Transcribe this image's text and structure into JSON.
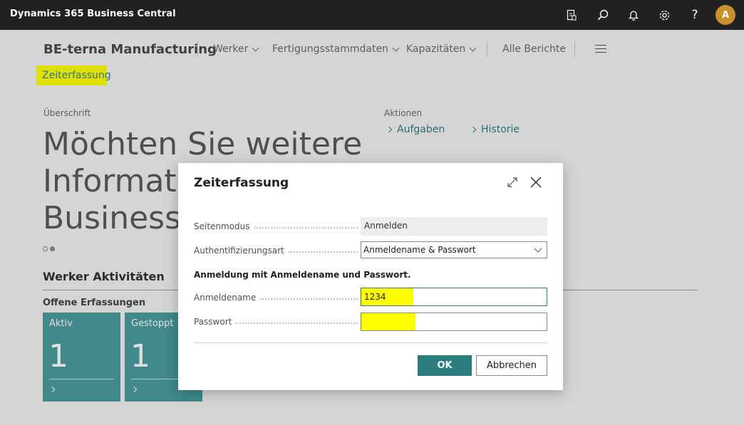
{
  "app": {
    "title": "Dynamics 365 Business Central",
    "avatar_initial": "A"
  },
  "topbar_icons": [
    "document-icon",
    "search-icon",
    "bell-icon",
    "gear-icon",
    "help-icon"
  ],
  "header": {
    "company": "BE-terna Manufacturing",
    "nav": [
      {
        "label": "Werker"
      },
      {
        "label": "Fertigungsstammdaten"
      },
      {
        "label": "Kapazitäten"
      }
    ],
    "all_reports": "Alle Berichte",
    "highlight_link": "Zeiterfassung"
  },
  "headline": {
    "caption": "Überschrift",
    "lines": [
      "Möchten Sie weitere",
      "Informatio",
      "Business C"
    ]
  },
  "actions": {
    "caption": "Aktionen",
    "items": [
      "Aufgaben",
      "Historie"
    ]
  },
  "activities": {
    "title": "Werker Aktivitäten",
    "subtitle": "Offene Erfassungen",
    "tiles": [
      {
        "label": "Aktiv",
        "value": "1"
      },
      {
        "label": "Gestoppt",
        "value": "1"
      }
    ]
  },
  "dialog": {
    "title": "Zeiterfassung",
    "fields": {
      "page_mode": {
        "label": "Seitenmodus",
        "value": "Anmelden"
      },
      "auth_type": {
        "label": "Authentifizierungsart",
        "value": "Anmeldename & Passwort"
      },
      "group_heading": "Anmeldung mit Anmeldename und Passwort.",
      "login_name": {
        "label": "Anmeldename",
        "value": "1234"
      },
      "password": {
        "label": "Passwort",
        "value": ""
      }
    },
    "buttons": {
      "ok": "OK",
      "cancel": "Abbrechen"
    }
  },
  "colors": {
    "accent": "#2c7d7e",
    "tile": "#4a9d9e",
    "highlight": "#ffff00",
    "topbar": "#212121"
  }
}
